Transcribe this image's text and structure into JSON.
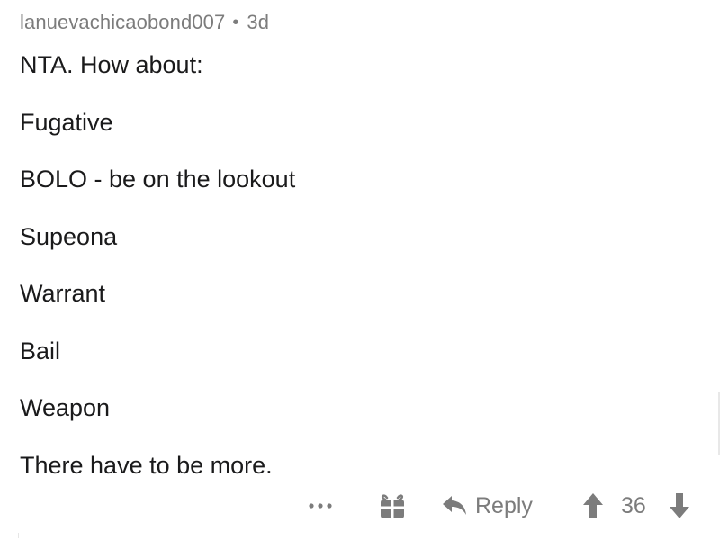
{
  "comment": {
    "username": "lanuevachicaobond007",
    "separator": "•",
    "age": "3d",
    "lines": [
      "NTA. How about:",
      "Fugative",
      "BOLO - be on the lookout",
      "Supeona",
      "Warrant",
      "Bail",
      "Weapon",
      "There have to be more."
    ]
  },
  "actions": {
    "more_label": "...",
    "gift_icon": "gift-icon",
    "reply_icon": "reply-arrow-icon",
    "reply_label": "Reply",
    "upvote_icon": "upvote-arrow-icon",
    "score": "36",
    "downvote_icon": "downvote-arrow-icon"
  },
  "colors": {
    "text": "#1a1a1b",
    "meta": "#7c7c7c",
    "background": "#ffffff"
  }
}
